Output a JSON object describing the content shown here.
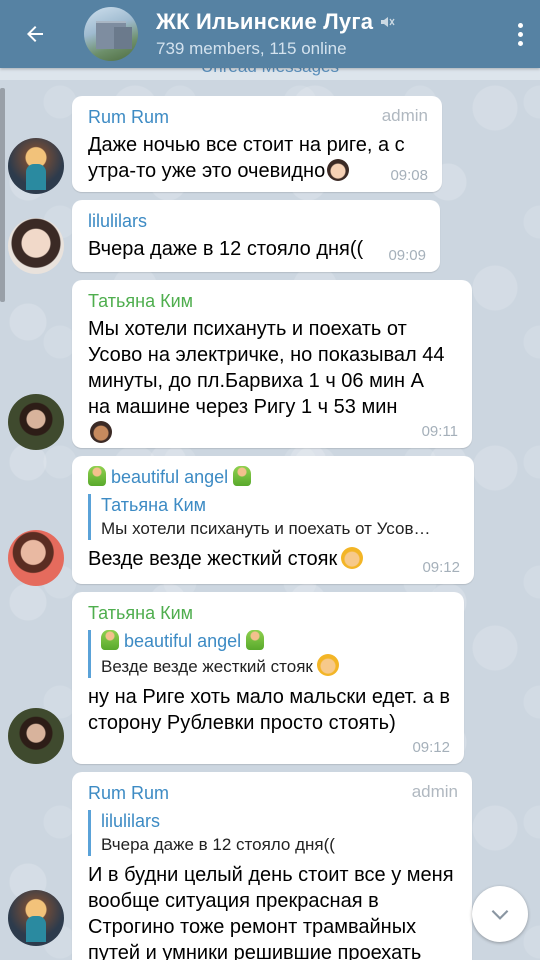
{
  "header": {
    "title": "ЖК Ильинские Луга",
    "subtitle": "739 members, 115 online",
    "unread_label": "Unread Messages"
  },
  "colors": {
    "header_bg": "#5682a3",
    "admin_name": "#3d8bc4",
    "tatyana_name": "#4fae4e",
    "lil_name": "#3d8bc4",
    "angel_name": "#3d8bc4"
  },
  "messages": [
    {
      "sender": "Rum Rum",
      "admin": "admin",
      "text": "Даже ночью все стоит на риге, а с утра-то уже это очевидно",
      "time": "09:08"
    },
    {
      "sender": "lilulilars",
      "text": "Вчера даже в 12 стояло дня((",
      "time": "09:09"
    },
    {
      "sender": "Татьяна Ким",
      "text": "Мы хотели психануть и поехать от Усово на электричке, но показывал 44 минуты, до пл.Барвиха 1 ч 06 мин А на машине через Ригу 1 ч 53 мин",
      "time": "09:11"
    },
    {
      "sender": "beautiful angel",
      "reply_name": "Татьяна Ким",
      "reply_text": "Мы хотели психануть и поехать от Усов…",
      "text": "Везде везде жесткий стояк",
      "time": "09:12"
    },
    {
      "sender": "Татьяна Ким",
      "reply_name": "beautiful angel",
      "reply_text": "Везде везде жесткий стояк",
      "text": "ну на Риге хоть мало мальски едет. а в сторону Рублевки просто стоять)",
      "time": "09:12"
    },
    {
      "sender": "Rum Rum",
      "admin": "admin",
      "reply_name": "lilulilars",
      "reply_text": "Вчера даже в 12 стояло дня((",
      "text": "И в будни целый день стоит все у меня вообще ситуация прекрасная в Строгино тоже ремонт трамвайных путей и умники решившие проехать"
    }
  ]
}
